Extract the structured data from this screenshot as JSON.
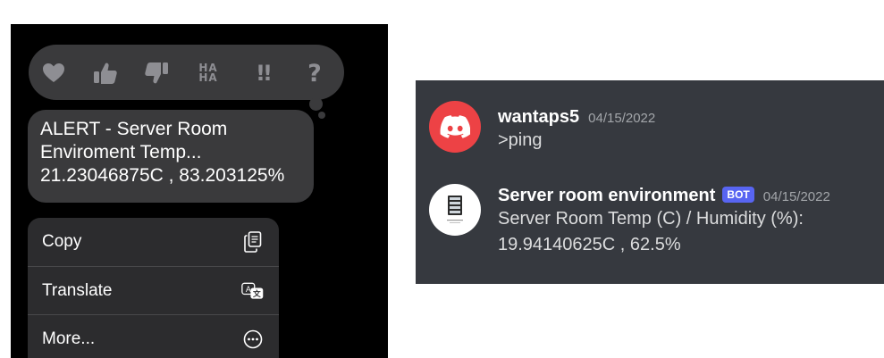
{
  "ios": {
    "tapbacks": [
      {
        "name": "heart",
        "icon": "heart-icon"
      },
      {
        "name": "thumbs-up",
        "icon": "thumbs-up-icon"
      },
      {
        "name": "thumbs-down",
        "icon": "thumbs-down-icon"
      },
      {
        "name": "haha",
        "label_top": "HA",
        "label_bottom": "HA"
      },
      {
        "name": "emphasize",
        "label": "!!"
      },
      {
        "name": "question",
        "label": "?"
      }
    ],
    "alert_message": {
      "line1": "ALERT - Server Room",
      "line2": "Enviroment Temp...",
      "line3": "21.23046875C , 83.203125%"
    },
    "menu": {
      "items": [
        {
          "label": "Copy",
          "icon": "copy-icon"
        },
        {
          "label": "Translate",
          "icon": "translate-icon"
        },
        {
          "label": "More...",
          "icon": "more-icon"
        }
      ]
    },
    "colors": {
      "bubble": "#3a3a3c",
      "menu": "#2c2c2e",
      "background": "#000000"
    }
  },
  "discord": {
    "messages": [
      {
        "username": "wantaps5",
        "timestamp": "04/15/2022",
        "lines": [
          ">ping"
        ],
        "avatar": "discord-logo-icon"
      },
      {
        "username": "Server room environment",
        "badge": "BOT",
        "timestamp": "04/15/2022",
        "lines": [
          "Server Room Temp (C) / Humidity (%):",
          "19.94140625C , 62.5%"
        ],
        "avatar": "server-rack-icon"
      }
    ],
    "colors": {
      "background": "#36393f",
      "avatar_red": "#ed4245",
      "bot_badge": "#5865f2"
    }
  }
}
